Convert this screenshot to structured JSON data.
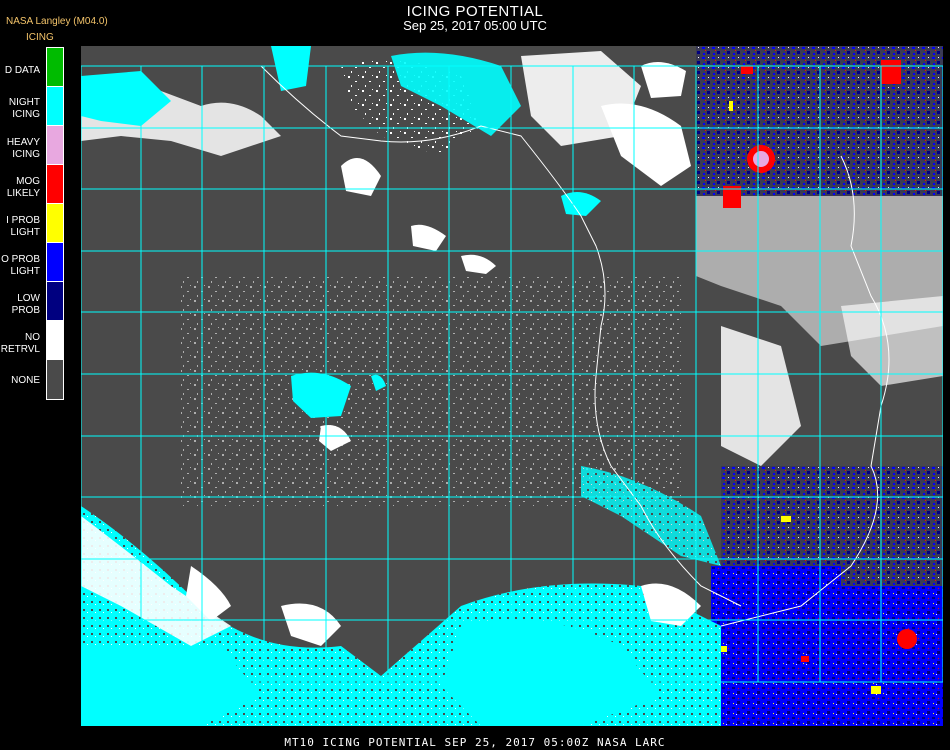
{
  "header": {
    "title": "ICING POTENTIAL",
    "subtitle": "Sep 25, 2017 05:00 UTC",
    "source": "NASA Langley (M04.0)",
    "product": "ICING"
  },
  "legend": {
    "items": [
      {
        "label": "D DATA",
        "color": "#00bb00"
      },
      {
        "label": "NIGHT\nICING",
        "color": "#00ffff"
      },
      {
        "label": "HEAVY\nICING",
        "color": "#e8a8e0"
      },
      {
        "label": "MOG\nLIKELY",
        "color": "#ff0000"
      },
      {
        "label": "I PROB\nLIGHT",
        "color": "#ffff00"
      },
      {
        "label": "O PROB\nLIGHT",
        "color": "#0000ff"
      },
      {
        "label": "LOW\nPROB",
        "color": "#000080"
      },
      {
        "label": "NO\nRETRVL",
        "color": "#ffffff"
      },
      {
        "label": "NONE",
        "color": "#4a4a4a"
      }
    ]
  },
  "footer": {
    "text": "MT10  ICING POTENTIAL   SEP 25, 2017 05:00Z   NASA LARC"
  },
  "colors": {
    "background": "#000000",
    "map_none": "#4a4a4a",
    "grid": "#00ffff",
    "title_accent": "#f4c46a",
    "night_icing": "#00ffff",
    "no_retrieval": "#ffffff",
    "low_prob": "#000080",
    "o_prob_light": "#0000ff",
    "mog_likely": "#ff0000",
    "i_prob_light": "#ffff00",
    "heavy_icing": "#e8a8e0"
  }
}
